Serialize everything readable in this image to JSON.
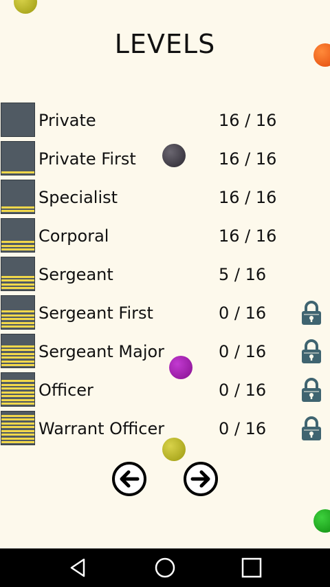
{
  "header": {
    "title": "LEVELS"
  },
  "levels": [
    {
      "name": "Private",
      "progress": "16 / 16",
      "stripes": 0,
      "locked": false
    },
    {
      "name": "Private First",
      "progress": "16 / 16",
      "stripes": 1,
      "locked": false
    },
    {
      "name": "Specialist",
      "progress": "16 / 16",
      "stripes": 2,
      "locked": false
    },
    {
      "name": "Corporal",
      "progress": "16 / 16",
      "stripes": 3,
      "locked": false
    },
    {
      "name": "Sergeant",
      "progress": "5 / 16",
      "stripes": 4,
      "locked": false
    },
    {
      "name": "Sergeant First",
      "progress": "0 / 16",
      "stripes": 5,
      "locked": true
    },
    {
      "name": "Sergeant Major",
      "progress": "0 / 16",
      "stripes": 6,
      "locked": true
    },
    {
      "name": "Officer",
      "progress": "0 / 16",
      "stripes": 7,
      "locked": true
    },
    {
      "name": "Warrant Officer",
      "progress": "0 / 16",
      "stripes": 8,
      "locked": true
    }
  ],
  "colors": {
    "background": "#fdf9ec",
    "badge": "#505a63",
    "stripe": "#f2d84a",
    "lock": "#3f6470"
  },
  "icons": {
    "prev": "arrow-left-circle-icon",
    "next": "arrow-right-circle-icon",
    "lock": "padlock-icon",
    "system_back": "triangle-back-icon",
    "system_home": "circle-home-icon",
    "system_recents": "square-recents-icon"
  }
}
